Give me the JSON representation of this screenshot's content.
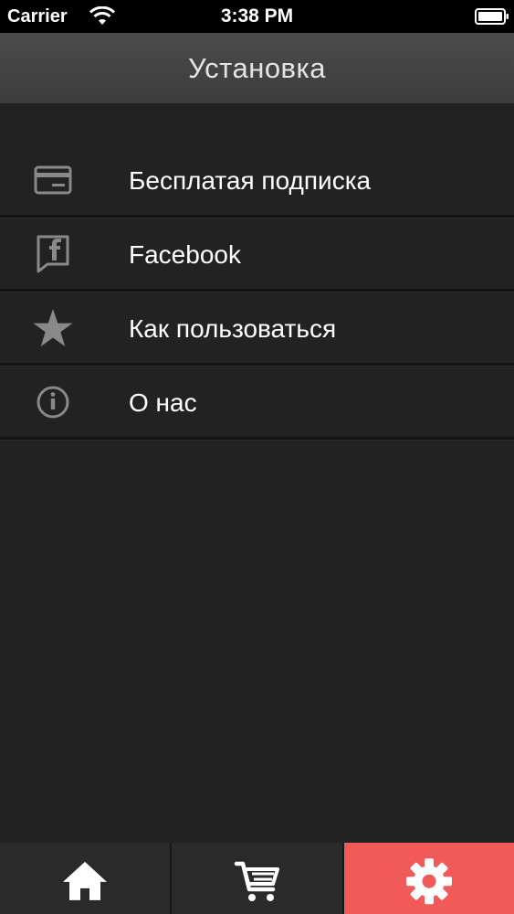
{
  "status_bar": {
    "carrier": "Carrier",
    "time": "3:38 PM"
  },
  "nav": {
    "title": "Установка"
  },
  "menu": {
    "items": [
      {
        "label": "Бесплатая подписка",
        "icon": "credit-card-icon"
      },
      {
        "label": "Facebook",
        "icon": "facebook-icon"
      },
      {
        "label": "Как пользоваться",
        "icon": "star-icon"
      },
      {
        "label": "О нас",
        "icon": "info-icon"
      }
    ]
  },
  "tab_bar": {
    "tabs": [
      {
        "name": "home",
        "icon": "home-icon",
        "selected": false
      },
      {
        "name": "cart",
        "icon": "cart-icon",
        "selected": false
      },
      {
        "name": "settings",
        "icon": "gear-icon",
        "selected": true
      }
    ]
  },
  "colors": {
    "background": "#232223",
    "nav_bar": "#444344",
    "accent": "#f25a5a",
    "icon_gray": "#8a898a",
    "text": "#ffffff"
  }
}
